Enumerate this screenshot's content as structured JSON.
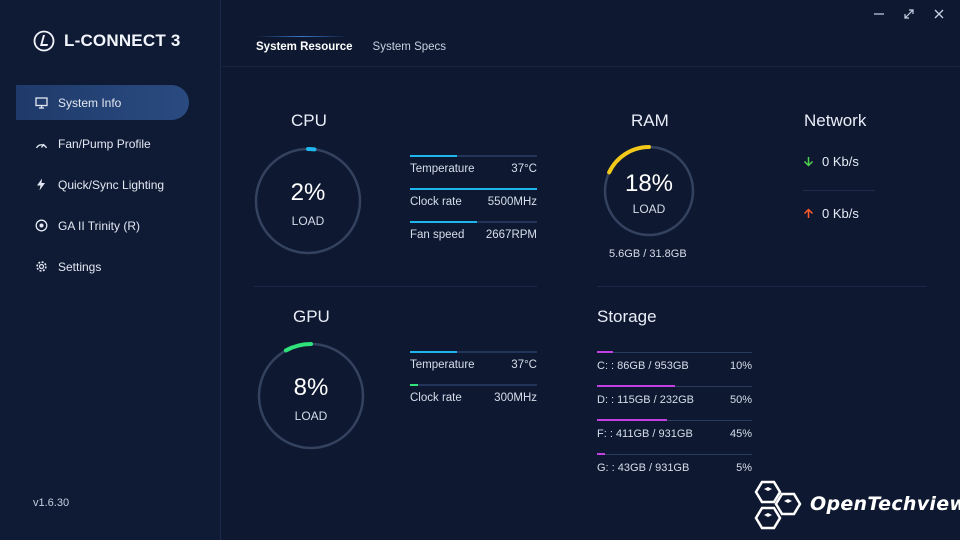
{
  "app": {
    "name": "L-CONNECT 3",
    "version": "v1.6.30"
  },
  "sidebar": {
    "items": [
      {
        "label": "System Info",
        "icon": "monitor-icon",
        "active": true
      },
      {
        "label": "Fan/Pump Profile",
        "icon": "fan-curve-icon",
        "active": false
      },
      {
        "label": "Quick/Sync Lighting",
        "icon": "lightning-icon",
        "active": false
      },
      {
        "label": "GA II Trinity (R)",
        "icon": "device-icon",
        "active": false
      },
      {
        "label": "Settings",
        "icon": "gear-icon",
        "active": false
      }
    ]
  },
  "window_controls": {
    "minimize": "minimize-icon",
    "maximize": "maximize-icon",
    "close": "close-icon"
  },
  "tabs": [
    {
      "label": "System Resource",
      "active": true
    },
    {
      "label": "System Specs",
      "active": false
    }
  ],
  "cpu": {
    "title": "CPU",
    "load_value": "2%",
    "load_fraction": 0.02,
    "load_label": "LOAD",
    "accent": "#1fb6f0",
    "stats": [
      {
        "label": "Temperature",
        "value": "37°C",
        "fill": 0.37
      },
      {
        "label": "Clock rate",
        "value": "5500MHz",
        "fill": 1.0
      },
      {
        "label": "Fan speed",
        "value": "2667RPM",
        "fill": 0.53
      }
    ]
  },
  "gpu": {
    "title": "GPU",
    "load_value": "8%",
    "load_fraction": 0.08,
    "load_label": "LOAD",
    "accent": "#2fe27a",
    "stats": [
      {
        "label": "Temperature",
        "value": "37°C",
        "fill": 0.37,
        "color": "#1fb6f0"
      },
      {
        "label": "Clock rate",
        "value": "300MHz",
        "fill": 0.06,
        "color": "#2fe27a"
      }
    ]
  },
  "ram": {
    "title": "RAM",
    "load_value": "18%",
    "load_fraction": 0.18,
    "load_label": "LOAD",
    "accent": "#f2c81a",
    "usage": "5.6GB / 31.8GB"
  },
  "network": {
    "title": "Network",
    "download": "0 Kb/s",
    "upload": "0 Kb/s",
    "download_color": "#4fd24f",
    "upload_color": "#ff5a2a"
  },
  "storage": {
    "title": "Storage",
    "accent": "#c23fe0",
    "drives": [
      {
        "label": "C: : 86GB / 953GB",
        "value": "10%",
        "fraction": 0.1
      },
      {
        "label": "D: : 115GB / 232GB",
        "value": "50%",
        "fraction": 0.5
      },
      {
        "label": "F: : 411GB / 931GB",
        "value": "45%",
        "fraction": 0.45
      },
      {
        "label": "G: : 43GB / 931GB",
        "value": "5%",
        "fraction": 0.05
      }
    ]
  },
  "watermark": {
    "text": "OpenTechview"
  }
}
